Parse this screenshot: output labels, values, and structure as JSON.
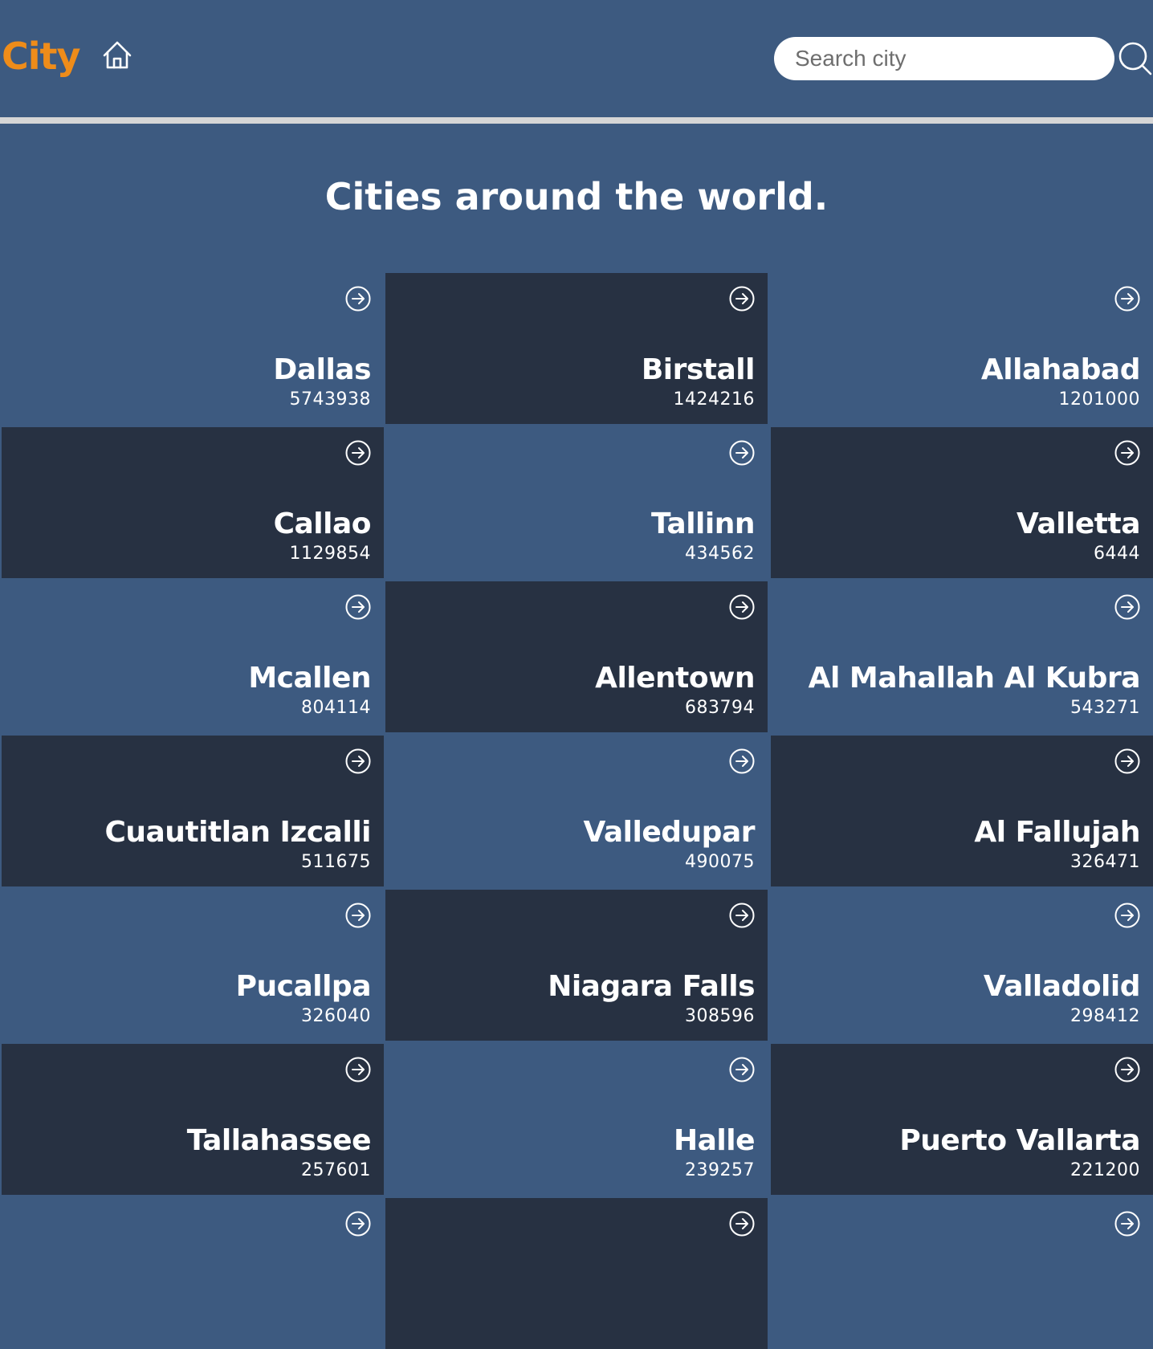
{
  "header": {
    "logo": "City",
    "search_placeholder": "Search city"
  },
  "main": {
    "title": "Cities around the world."
  },
  "icons": {
    "home": "home-icon",
    "search": "search-icon",
    "card_arrow": "arrow-right-circle-icon"
  },
  "colors": {
    "background": "#3d5a80",
    "card_dark": "#273142",
    "logo": "#ee8c1a",
    "divider": "#d6d6d6"
  },
  "cities": [
    {
      "name": "Dallas",
      "population": "5743938"
    },
    {
      "name": "Birstall",
      "population": "1424216"
    },
    {
      "name": "Allahabad",
      "population": "1201000"
    },
    {
      "name": "Callao",
      "population": "1129854"
    },
    {
      "name": "Tallinn",
      "population": "434562"
    },
    {
      "name": "Valletta",
      "population": "6444"
    },
    {
      "name": "Mcallen",
      "population": "804114"
    },
    {
      "name": "Allentown",
      "population": "683794"
    },
    {
      "name": "Al Mahallah Al Kubra",
      "population": "543271"
    },
    {
      "name": "Cuautitlan Izcalli",
      "population": "511675"
    },
    {
      "name": "Valledupar",
      "population": "490075"
    },
    {
      "name": "Al Fallujah",
      "population": "326471"
    },
    {
      "name": "Pucallpa",
      "population": "326040"
    },
    {
      "name": "Niagara Falls",
      "population": "308596"
    },
    {
      "name": "Valladolid",
      "population": "298412"
    },
    {
      "name": "Tallahassee",
      "population": "257601"
    },
    {
      "name": "Halle",
      "population": "239257"
    },
    {
      "name": "Puerto Vallarta",
      "population": "221200"
    },
    {
      "name": "",
      "population": ""
    },
    {
      "name": "",
      "population": ""
    },
    {
      "name": "",
      "population": ""
    }
  ]
}
